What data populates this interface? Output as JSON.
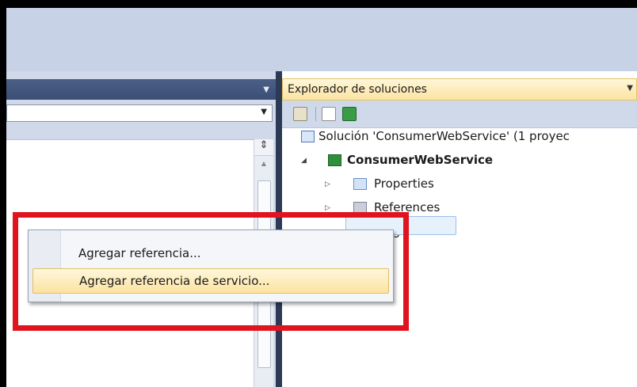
{
  "left_pane": {
    "dropdown_value": ""
  },
  "solution_explorer": {
    "title": "Explorador de soluciones",
    "solution": "Solución 'ConsumerWebService'  (1 proyec",
    "project": "ConsumerWebService",
    "items": [
      "Properties",
      "References",
      "Program.cs"
    ]
  },
  "context_menu": {
    "items": [
      "Agregar referencia...",
      "Agregar referencia de servicio..."
    ],
    "selected_index": 1
  },
  "colors": {
    "annotation": "#e0141e",
    "selection": "#fbe3a0"
  },
  "icons": [
    "split-icon",
    "properties-icon",
    "show-all-files-icon",
    "refresh-icon",
    "solution-icon",
    "csharp-project-icon",
    "folder-icon",
    "references-icon",
    "csharp-file-icon"
  ]
}
